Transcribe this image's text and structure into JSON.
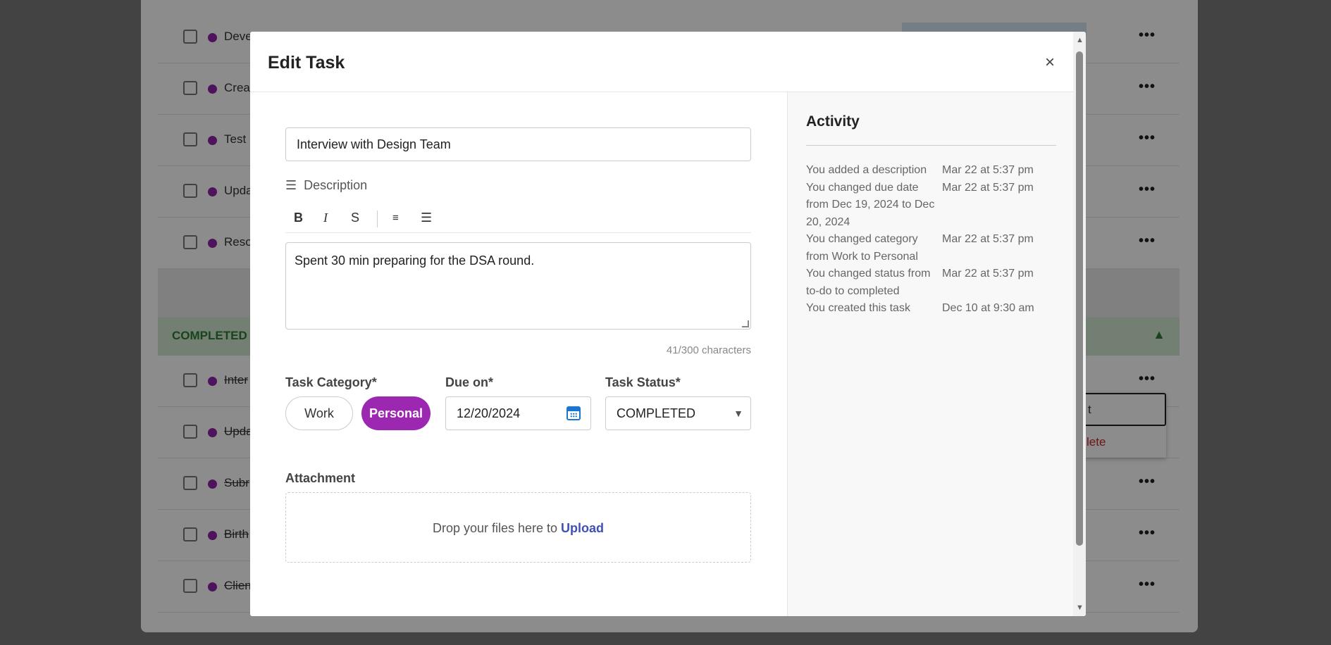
{
  "background": {
    "rows": [
      {
        "text": "Deve",
        "done": false
      },
      {
        "text": "Crea",
        "done": false
      },
      {
        "text": "Test .",
        "done": false
      },
      {
        "text": "Upda",
        "done": false
      },
      {
        "text": "Reso",
        "done": false
      }
    ],
    "completed_header": "COMPLETED (",
    "completed_rows": [
      {
        "text": "Inter",
        "done": true
      },
      {
        "text": "Upda",
        "done": true
      },
      {
        "text": "Subr",
        "done": true
      },
      {
        "text": "Birth",
        "done": true
      },
      {
        "text": "Clien",
        "done": true
      }
    ],
    "more_label": "•••",
    "menu_edit": "t",
    "menu_delete": "lete"
  },
  "modal": {
    "title": "Edit Task",
    "close_label": "×",
    "task_title": "Interview with Design Team",
    "description_label": "Description",
    "toolbar": {
      "bold": "B",
      "italic": "I",
      "strike": "S",
      "ordered": "≡",
      "bullets": "☰"
    },
    "description_text": "Spent 30 min preparing for the DSA round.",
    "char_count": "41/300 characters",
    "category_label": "Task Category*",
    "category_options": [
      "Work",
      "Personal"
    ],
    "category_selected": "Personal",
    "due_label": "Due on*",
    "due_value": "12/20/2024",
    "status_label": "Task Status*",
    "status_value": "COMPLETED",
    "attachment_label": "Attachment",
    "drop_text": "Drop your files here to ",
    "upload_label": "Upload"
  },
  "activity": {
    "title": "Activity",
    "items": [
      {
        "text": "You added a description",
        "time": "Mar 22 at 5:37 pm"
      },
      {
        "text": "You changed due date from Dec 19, 2024 to Dec 20, 2024",
        "time": "Mar 22 at 5:37 pm"
      },
      {
        "text": "You changed category from Work to Personal",
        "time": "Mar 22 at 5:37 pm"
      },
      {
        "text": "You changed status from to-do to completed",
        "time": "Mar 22 at 5:37 pm"
      },
      {
        "text": "You created this task",
        "time": "Dec 10 at 9:30 am"
      }
    ]
  },
  "colors": {
    "accent": "#9c27b0",
    "upload": "#3f51b5",
    "completed_bg": "#cfe8cf",
    "completed_text": "#2e7d32"
  }
}
